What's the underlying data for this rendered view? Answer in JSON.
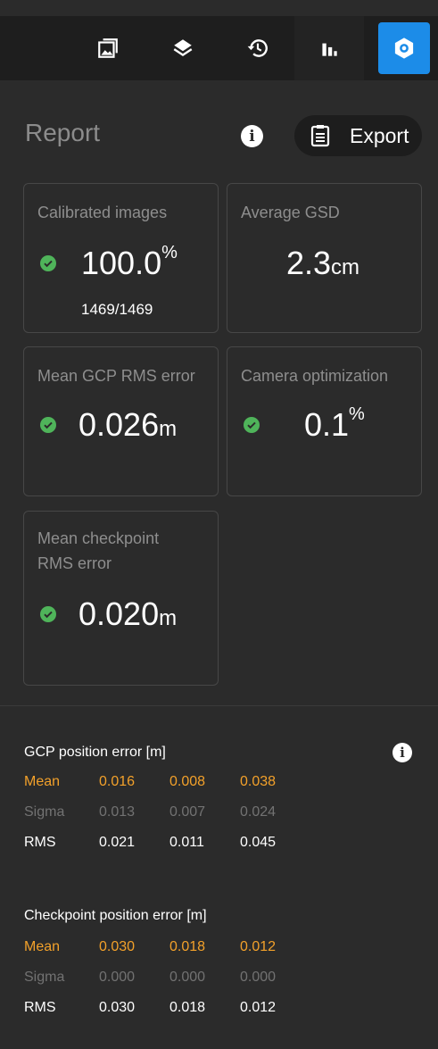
{
  "colors": {
    "accent": "#1c8ce8",
    "success": "#4fb45a",
    "mean": "#f3a12a",
    "sigma": "#727272"
  },
  "toolbar": {
    "tabs": [
      {
        "icon": "image-icon"
      },
      {
        "icon": "layers-icon"
      },
      {
        "icon": "history-icon"
      },
      {
        "icon": "bar-chart-icon",
        "active": true
      },
      {
        "icon": "settings-icon",
        "highlighted": true
      }
    ]
  },
  "report": {
    "title": "Report",
    "export_label": "Export",
    "info_glyph": "i"
  },
  "cards": {
    "calibrated": {
      "title": "Calibrated images",
      "value": "100.0",
      "unit": "%",
      "sub": "1469/1469"
    },
    "gsd": {
      "title": "Average GSD",
      "value": "2.3",
      "unit": "cm"
    },
    "gcp_rms": {
      "title": "Mean GCP RMS error",
      "value": "0.026",
      "unit": "m"
    },
    "camera": {
      "title": "Camera optimization",
      "value": "0.1",
      "unit": "%"
    },
    "checkpoint_rms": {
      "title_line1": "Mean checkpoint",
      "title_line2": "RMS error",
      "value": "0.020",
      "unit": "m"
    }
  },
  "gcp_table": {
    "title": "GCP position error [m]",
    "rows": [
      {
        "label": "Mean",
        "values": [
          "0.016",
          "0.008",
          "0.038"
        ]
      },
      {
        "label": "Sigma",
        "values": [
          "0.013",
          "0.007",
          "0.024"
        ]
      },
      {
        "label": "RMS",
        "values": [
          "0.021",
          "0.011",
          "0.045"
        ]
      }
    ]
  },
  "checkpoint_table": {
    "title": "Checkpoint position error [m]",
    "rows": [
      {
        "label": "Mean",
        "values": [
          "0.030",
          "0.018",
          "0.012"
        ]
      },
      {
        "label": "Sigma",
        "values": [
          "0.000",
          "0.000",
          "0.000"
        ]
      },
      {
        "label": "RMS",
        "values": [
          "0.030",
          "0.018",
          "0.012"
        ]
      }
    ]
  }
}
